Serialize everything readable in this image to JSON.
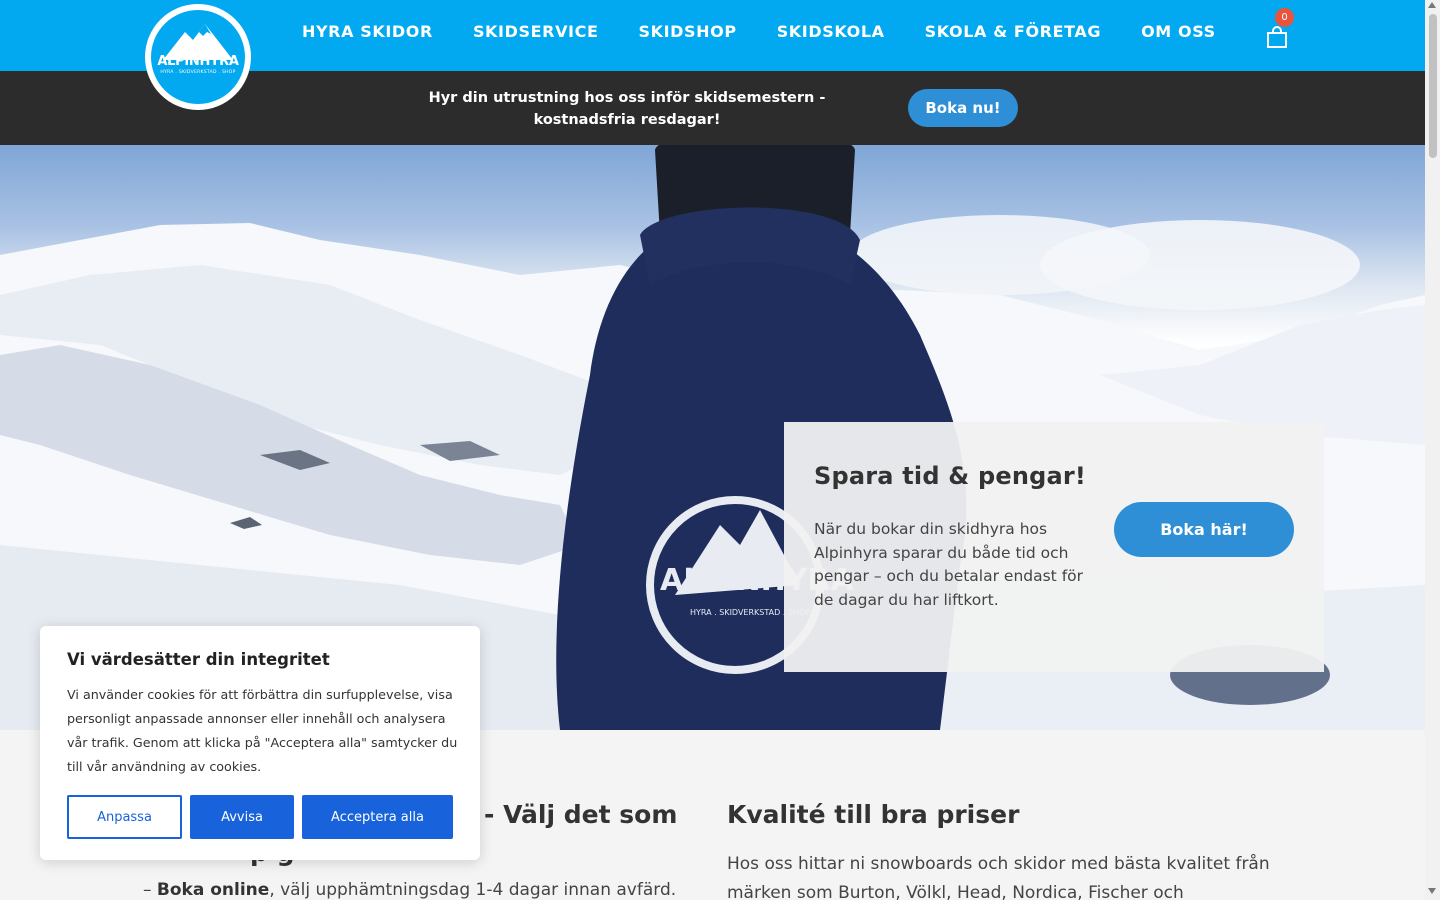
{
  "brand": {
    "logo_text": "ALPINHYRA",
    "logo_subtext": "HYRA . SKIDVERKSTAD . SHOP"
  },
  "nav": {
    "items": [
      {
        "label": "HYRA SKIDOR"
      },
      {
        "label": "SKIDSERVICE"
      },
      {
        "label": "SKIDSHOP"
      },
      {
        "label": "SKIDSKOLA"
      },
      {
        "label": "SKOLA & FÖRETAG"
      },
      {
        "label": "OM OSS"
      }
    ],
    "cart_count": "0",
    "cart_icon": "shopping-bag-icon"
  },
  "promo": {
    "text": "Hyr din utrustning hos oss inför skidsemestern - kostnadsfria resdagar!",
    "button_label": "Boka nu!"
  },
  "hero": {
    "card_title": "Spara tid & pengar!",
    "card_text": "När du bokar din skidhyra hos Alpinhyra sparar du både tid och pengar – och du betalar endast för de dagar du har liftkort.",
    "card_button_label": "Boka här!",
    "jacket_text": "ALPINHYRA",
    "jacket_subtext": "HYRA . SKIDVERKSTAD . SHOP"
  },
  "content": {
    "left_title_visible": "- Välj det som",
    "left_title_fragment": "p    g",
    "left_line_prefix": "– ",
    "left_line_bold": "Boka online",
    "left_line_rest": ", välj upphämtningsdag 1-4 dagar innan avfärd.",
    "right_title": "Kvalité till bra priser",
    "right_text": "Hos oss hittar ni snowboards och skidor med bästa kvalitet från märken som Burton, Völkl, Head, Nordica, Fischer och"
  },
  "cookie": {
    "title": "Vi värdesätter din integritet",
    "text": "Vi använder cookies för att förbättra din surfupplevelse, visa personligt anpassade annonser eller innehåll och analysera vår trafik. Genom att klicka på \"Acceptera alla\" samtycker du till vår användning av cookies.",
    "customize_label": "Anpassa",
    "reject_label": "Avvisa",
    "accept_label": "Acceptera alla"
  },
  "colors": {
    "header_bg": "#02a9f0",
    "promo_bg": "#2c2c2c",
    "button_blue": "#2e8fd6",
    "cookie_blue": "#1863dc",
    "badge_red": "#e8553e"
  }
}
